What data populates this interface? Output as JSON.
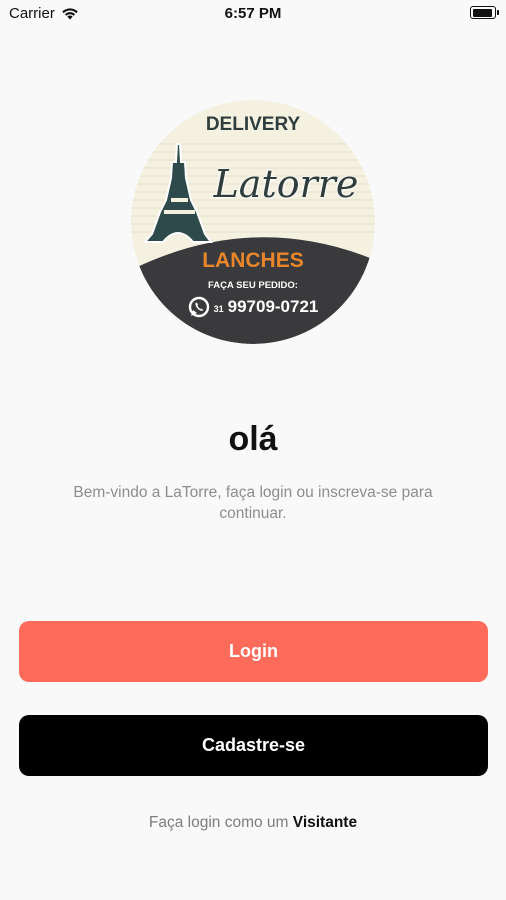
{
  "status_bar": {
    "carrier": "Carrier",
    "time": "6:57 PM"
  },
  "logo": {
    "top_text": "DELIVERY",
    "brand": "Latorre",
    "category": "LANCHES",
    "order_prompt": "FAÇA SEU PEDIDO:",
    "phone_area": "31",
    "phone": "99709-0721"
  },
  "welcome": {
    "greeting": "olá",
    "message": "Bem-vindo a LaTorre, faça login ou inscreva-se para continuar."
  },
  "actions": {
    "login_label": "Login",
    "register_label": "Cadastre-se"
  },
  "guest": {
    "prefix": "Faça login como um ",
    "link_label": "Visitante"
  },
  "colors": {
    "background": "#f9f9f9",
    "login_button": "#ff6b5a",
    "register_button": "#000000",
    "logo_orange": "#e8862a",
    "logo_dark": "#3a3a3d",
    "logo_cream": "#f4f1e1"
  }
}
